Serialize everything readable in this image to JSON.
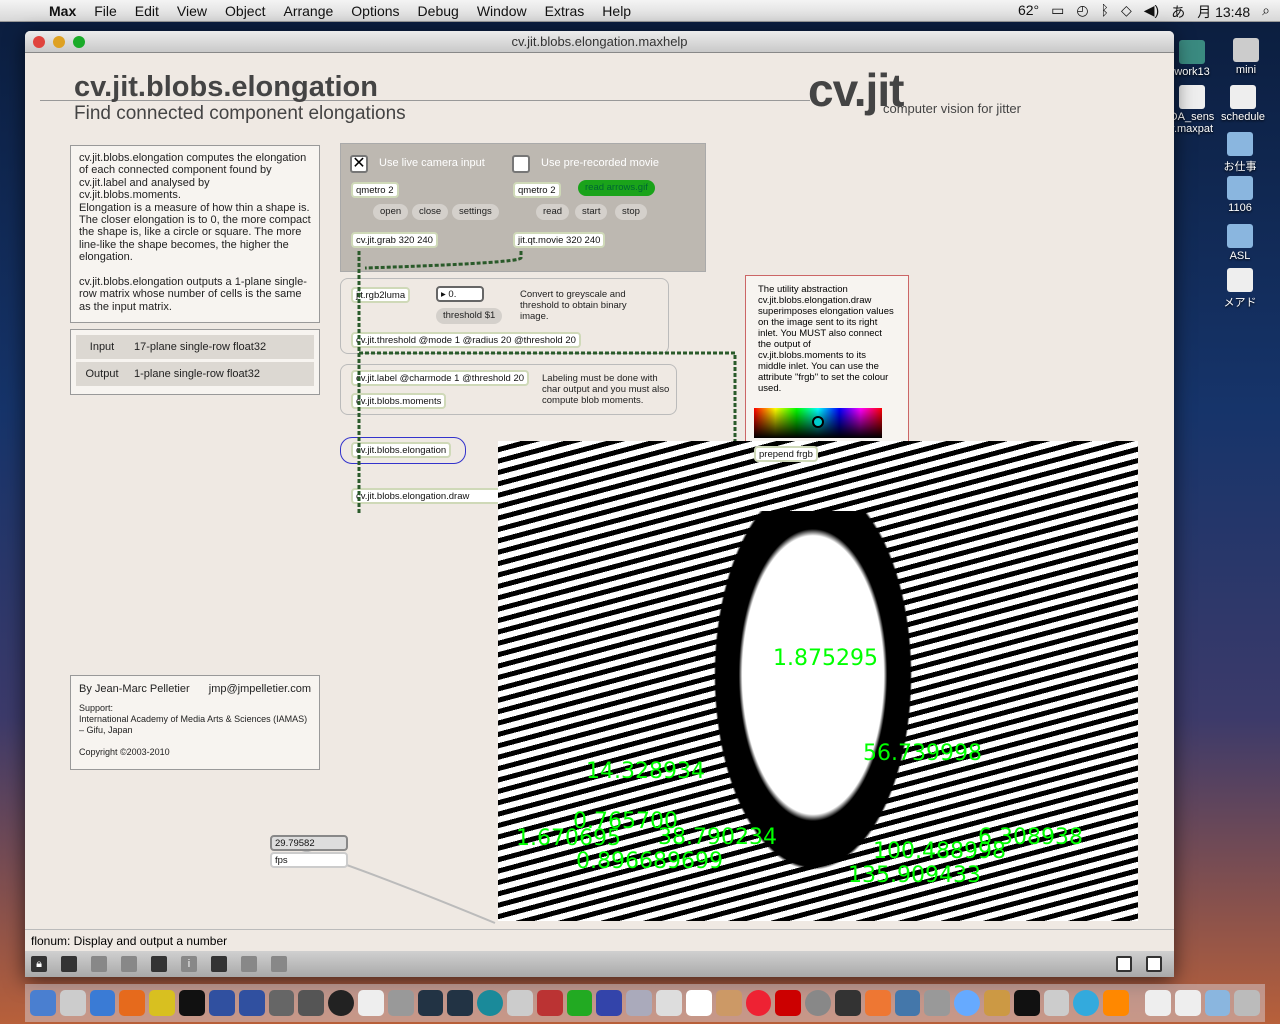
{
  "menubar": {
    "app": "Max",
    "items": [
      "File",
      "Edit",
      "View",
      "Object",
      "Arrange",
      "Options",
      "Debug",
      "Window",
      "Extras",
      "Help"
    ],
    "temp": "62°",
    "ime": "あ",
    "clock": "月 13:48"
  },
  "window": {
    "title": "cv.jit.blobs.elongation.maxhelp"
  },
  "header": {
    "title": "cv.jit.blobs.elongation",
    "subtitle": "Find connected component elongations",
    "logo": "cv.jit",
    "logo_sub": "computer vision for jitter"
  },
  "description": {
    "p1": "cv.jit.blobs.elongation computes the elongation of each connected component found by cv.jit.label and analysed by cv.jit.blobs.moments.",
    "p2": "Elongation is a measure of how thin a shape is. The closer elongation is to 0, the more compact the shape is, like a circle or square. The more line-like the shape becomes, the higher the elongation.",
    "p3": "cv.jit.blobs.elongation outputs a 1-plane single-row matrix whose number of cells is the same as the input matrix."
  },
  "io": [
    {
      "k": "Input",
      "v": "17-plane single-row float32"
    },
    {
      "k": "Output",
      "v": "1-plane single-row float32"
    }
  ],
  "author": {
    "by": "By Jean-Marc Pelletier",
    "email": "jmp@jmpelletier.com",
    "support": "Support:",
    "org": "International Academy of Media Arts & Sciences (IAMAS) – Gifu, Japan",
    "copyright": "Copyright ©2003-2010"
  },
  "patch": {
    "cam_label": "Use live camera input",
    "movie_label": "Use pre-recorded movie",
    "qmetro": "qmetro 2",
    "open": "open",
    "close": "close",
    "settings": "settings",
    "read_arrows": "read arrows.gif",
    "read": "read",
    "start": "start",
    "stop": "stop",
    "grab": "cv.jit.grab 320 240",
    "movie": "jit.qt.movie 320 240",
    "rgb2luma": "jit.rgb2luma",
    "flonum": "0.",
    "thresh_msg": "threshold $1",
    "thresh_cmt": "Convert to greyscale and threshold to obtain binary image.",
    "threshold": "cv.jit.threshold @mode 1 @radius 20 @threshold 20",
    "label": "cv.jit.label @charmode 1 @threshold 20",
    "label_cmt": "Labeling must be done with char output and you must also compute blob moments.",
    "moments": "cv.jit.blobs.moments",
    "elongation": "cv.jit.blobs.elongation",
    "draw": "cv.jit.blobs.elongation.draw",
    "prepend": "prepend frgb",
    "utility_cmt": "The utility abstraction cv.jit.blobs.elongation.draw superimposes elongation values on the image sent to its right inlet. You MUST also connect the output of cv.jit.blobs.moments to its middle inlet. You can use the attribute \"frgb\" to set the colour used.",
    "fps_value": "29.79582",
    "fps": "fps"
  },
  "overlay_numbers": [
    "1.875295",
    "14.328934",
    "56.739998",
    "0.765700",
    "38.790234",
    "6.308938",
    "100.488998",
    "135.909433",
    "1.670695",
    "0.896689699"
  ],
  "status": "flonum: Display and output a number",
  "desktop": [
    "work13",
    "mini",
    "DA_sens r.maxpat",
    "schedule",
    "お仕事",
    "1106",
    "ASL",
    "メアド"
  ],
  "colors": {
    "overlay": "#00ff00",
    "accent_msg": "#1aa31a"
  }
}
